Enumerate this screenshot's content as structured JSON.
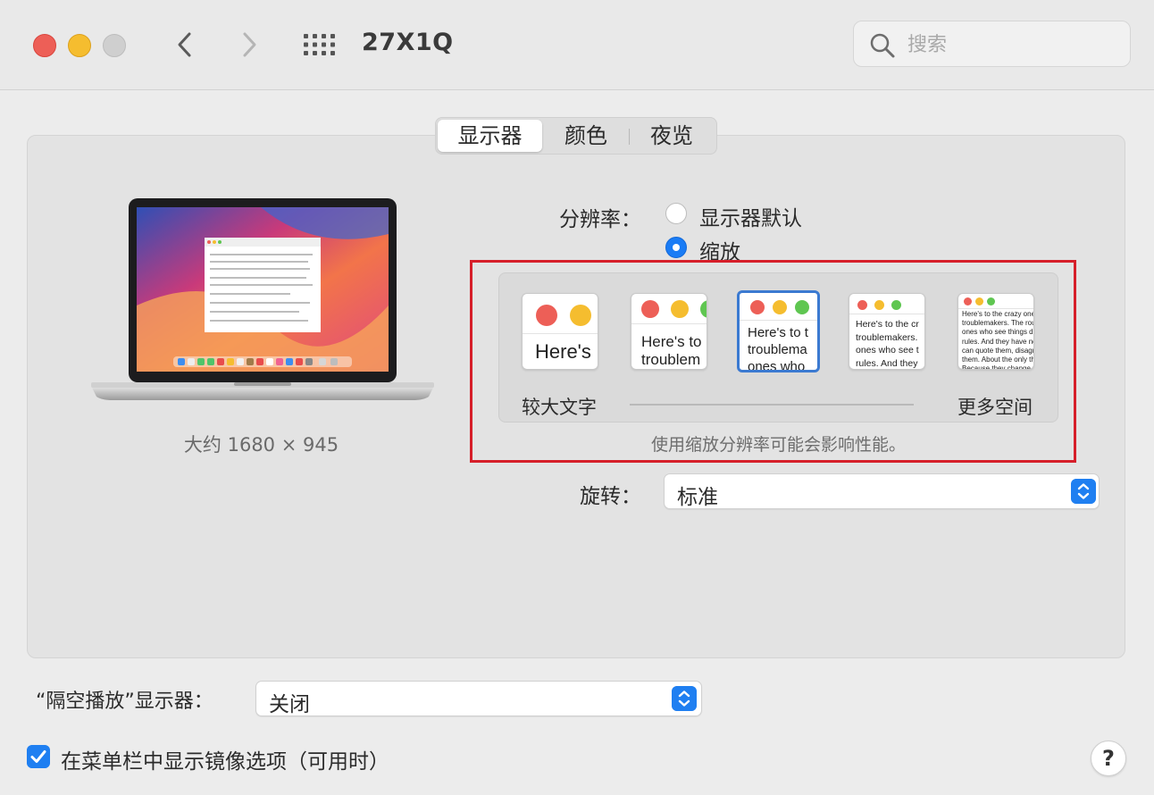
{
  "window": {
    "title": "27X1Q",
    "search_placeholder": "搜索"
  },
  "tabs": [
    {
      "label": "显示器",
      "active": true
    },
    {
      "label": "颜色",
      "active": false
    },
    {
      "label": "夜览",
      "active": false
    }
  ],
  "display": {
    "resolution_text": "大约 1680 × 945",
    "resolution_label": "分辨率：",
    "options": [
      {
        "label": "显示器默认",
        "selected": false
      },
      {
        "label": "缩放",
        "selected": true
      }
    ],
    "scale_left_label": "较大文字",
    "scale_right_label": "更多空间",
    "scale_selected_index": 2,
    "scale_thumbs": [
      {
        "text": "Here's"
      },
      {
        "text": "Here's to\ntroublem"
      },
      {
        "text": "Here's to t\ntroublema\nones who"
      },
      {
        "text": "Here's to the cr\ntroublemakers.\nones who see t\nrules. And they"
      },
      {
        "text": "Here's to the crazy one\ntroublemakers. The rou\nones who see things dif\nrules. And they have no\ncan quote them, disagr\nthem. About the only th\nBecause they change th"
      }
    ],
    "perf_note": "使用缩放分辨率可能会影响性能。",
    "rotation_label": "旋转：",
    "rotation_value": "标准"
  },
  "airplay": {
    "label": "“隔空播放”显示器：",
    "value": "关闭"
  },
  "mirror_option": {
    "label": "在菜单栏中显示镜像选项（可用时）",
    "checked": true
  },
  "help_label": "?",
  "colors": {
    "accent": "#1f7ff1",
    "highlight": "#d61f2a"
  }
}
